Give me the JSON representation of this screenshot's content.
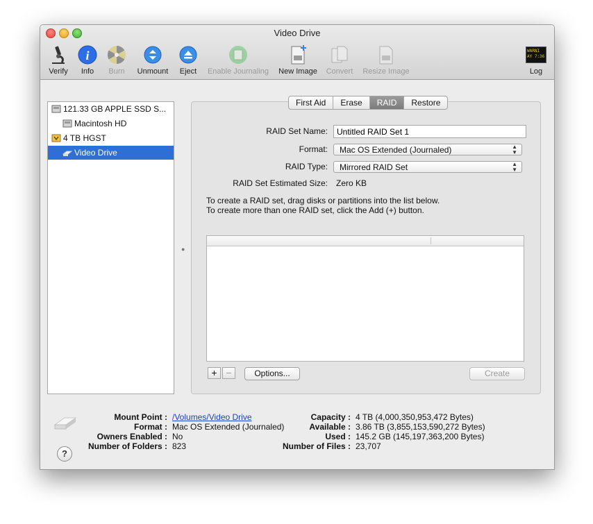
{
  "window": {
    "title": "Video Drive"
  },
  "toolbar": {
    "items": [
      {
        "label": "Verify",
        "icon": "microscope-icon",
        "enabled": true
      },
      {
        "label": "Info",
        "icon": "info-icon",
        "enabled": true
      },
      {
        "label": "Burn",
        "icon": "burn-icon",
        "enabled": false
      },
      {
        "label": "Unmount",
        "icon": "unmount-icon",
        "enabled": true
      },
      {
        "label": "Eject",
        "icon": "eject-icon",
        "enabled": true
      },
      {
        "label": "Enable Journaling",
        "icon": "journal-icon",
        "enabled": false
      },
      {
        "label": "New Image",
        "icon": "new-image-icon",
        "enabled": true
      },
      {
        "label": "Convert",
        "icon": "convert-icon",
        "enabled": false
      },
      {
        "label": "Resize Image",
        "icon": "resize-image-icon",
        "enabled": false
      },
      {
        "label": "Log",
        "icon": "log-icon",
        "enabled": true,
        "icon_text": "WARNI AY 7:36"
      }
    ]
  },
  "sidebar": {
    "devices": [
      {
        "label": "121.33 GB APPLE SSD S...",
        "level": 0,
        "selected": false,
        "icon": "internal-disk-icon"
      },
      {
        "label": "Macintosh HD",
        "level": 1,
        "selected": false,
        "icon": "internal-volume-icon"
      },
      {
        "label": "4 TB HGST",
        "level": 0,
        "selected": false,
        "icon": "external-disk-icon"
      },
      {
        "label": "Video Drive",
        "level": 1,
        "selected": true,
        "icon": "external-volume-icon"
      }
    ]
  },
  "tabs": [
    {
      "label": "First Aid",
      "active": false
    },
    {
      "label": "Erase",
      "active": false
    },
    {
      "label": "RAID",
      "active": true
    },
    {
      "label": "Restore",
      "active": false
    }
  ],
  "raid": {
    "set_name_label": "RAID Set Name:",
    "set_name_value": "Untitled RAID Set 1",
    "format_label": "Format:",
    "format_value": "Mac OS Extended (Journaled)",
    "type_label": "RAID Type:",
    "type_value": "Mirrored RAID Set",
    "size_label": "RAID Set Estimated Size:",
    "size_value": "Zero KB",
    "instructions_1": "To create a RAID set, drag disks or partitions into the list below.",
    "instructions_2": "To create more than one RAID set, click the Add (+) button.",
    "add_label": "+",
    "remove_label": "−",
    "options_label": "Options...",
    "create_label": "Create"
  },
  "info": {
    "mount_point_label": "Mount Point :",
    "mount_point_value": "/Volumes/Video Drive",
    "format_label": "Format :",
    "format_value": "Mac OS Extended (Journaled)",
    "owners_label": "Owners Enabled :",
    "owners_value": "No",
    "folders_label": "Number of Folders :",
    "folders_value": "823",
    "capacity_label": "Capacity :",
    "capacity_value": "4 TB (4,000,350,953,472 Bytes)",
    "available_label": "Available :",
    "available_value": "3.86 TB (3,855,153,590,272 Bytes)",
    "used_label": "Used :",
    "used_value": "145.2 GB (145,197,363,200 Bytes)",
    "files_label": "Number of Files :",
    "files_value": "23,707",
    "help_label": "?"
  },
  "colors": {
    "selection": "#2e6fd6",
    "info_blue": "#2d6ee6",
    "eject_blue": "#3b8ee8"
  }
}
